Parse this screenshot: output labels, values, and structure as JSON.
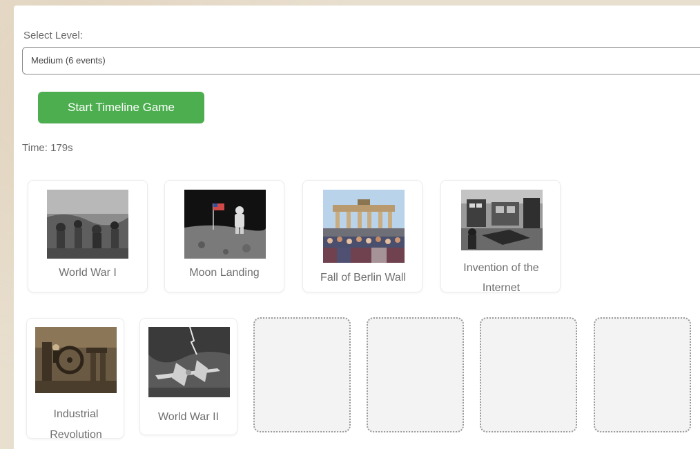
{
  "level": {
    "label": "Select Level:",
    "selected": "Medium (6 events)"
  },
  "start_button": "Start Timeline Game",
  "timer": "Time: 179s",
  "cards": [
    {
      "label": "World War I",
      "image": "soldiers-photo"
    },
    {
      "label": "Moon Landing",
      "image": "astronaut-flag-photo"
    },
    {
      "label": "Fall of Berlin Wall",
      "image": "brandenburg-gate-crowd-photo"
    },
    {
      "label": "Invention of the Internet",
      "image": "early-computer-room-photo"
    },
    {
      "label": "Industrial Revolution",
      "image": "factory-machinery-photo"
    },
    {
      "label": "World War II",
      "image": "bomber-plane-photo"
    }
  ],
  "slots_empty": 4,
  "colors": {
    "button": "#4cae4f",
    "slot_border": "#9a9a9a",
    "background": "#e9dfcf"
  }
}
